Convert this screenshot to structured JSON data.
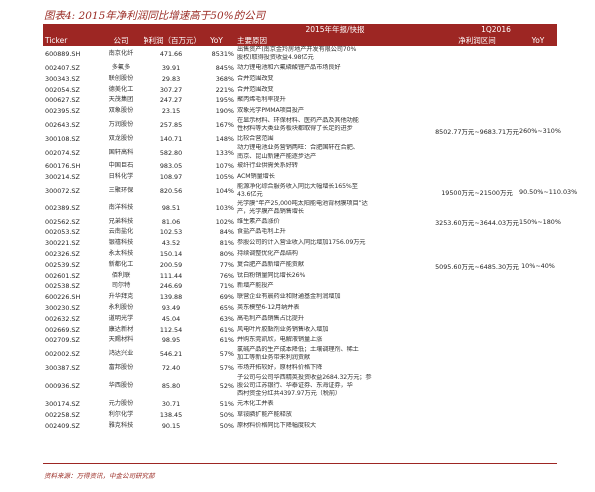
{
  "title": "图表4: 2015年净利润同比增速高于50%的公司",
  "header": {
    "group_2015": "2015年年报/快报",
    "group_1q2016": "1Q2016",
    "columns": [
      "Ticker",
      "公司",
      "净利润（百万元）",
      "YoY",
      "主要原因",
      "净利润区间",
      "YoY"
    ]
  },
  "rows": [
    {
      "ticker": "600889.SH",
      "name": "南京化纤",
      "profit": "471.66",
      "yoy": "8531%",
      "reason": [
        "出售资产(南京金羚房地产开发有限公司70%",
        "股权)取得投资收益4.98亿元"
      ]
    },
    {
      "ticker": "002407.SZ",
      "name": "多氟多",
      "profit": "39.91",
      "yoy": "845%",
      "reason": [
        "动力锂电池和六氟磷酸锂产品市场良好"
      ]
    },
    {
      "ticker": "300343.SZ",
      "name": "联创股份",
      "profit": "29.83",
      "yoy": "368%",
      "reason": [
        "合并范围改变"
      ]
    },
    {
      "ticker": "002054.SZ",
      "name": "德美化工",
      "profit": "307.27",
      "yoy": "221%",
      "reason": [
        "合并范围改变"
      ]
    },
    {
      "ticker": "000627.SZ",
      "name": "天茂集团",
      "profit": "247.27",
      "yoy": "195%",
      "reason": [
        "聚丙烯毛利率提升"
      ]
    },
    {
      "ticker": "002395.SZ",
      "name": "双象股份",
      "profit": "23.15",
      "yoy": "190%",
      "reason": [
        "双象光学PMMA项目投产"
      ]
    },
    {
      "ticker": "002643.SZ",
      "name": "万润股份",
      "profit": "257.85",
      "yoy": "167%",
      "reason": [
        "在显示材料、环保材料、医药产品及其他功能",
        "性材料等大类业务板块都取得了长足的进步"
      ]
    },
    {
      "ticker": "300108.SZ",
      "name": "双龙股份",
      "profit": "140.71",
      "yoy": "148%",
      "reason": [
        "比较合营范围"
      ]
    },
    {
      "ticker": "002074.SZ",
      "name": "国轩高科",
      "profit": "582.80",
      "yoy": "133%",
      "reason": [
        "动力锂电池业务营销两旺：合肥国轩在合肥、",
        "南京、昆山新建产能逐步达产"
      ]
    },
    {
      "ticker": "600176.SH",
      "name": "中国巨石",
      "profit": "983.05",
      "yoy": "107%",
      "reason": [
        "玻纤行业供需关系好转"
      ]
    },
    {
      "ticker": "300214.SZ",
      "name": "日科化学",
      "profit": "108.97",
      "yoy": "105%",
      "reason": [
        "ACM销量增长"
      ]
    },
    {
      "ticker": "300072.SZ",
      "name": "三聚环保",
      "profit": "820.56",
      "yoy": "104%",
      "reason": [
        "能源净化综合服务收入同比大幅增长165%至",
        "43.6亿元"
      ]
    },
    {
      "ticker": "002389.SZ",
      "name": "南洋科技",
      "profit": "98.51",
      "yoy": "103%",
      "reason": [
        "光学膜“年产25,000吨太阳能电池背材膜项目”达",
        "产，光学膜产品销售增长"
      ]
    },
    {
      "ticker": "002562.SZ",
      "name": "兄弟科技",
      "profit": "81.06",
      "yoy": "102%",
      "reason": [
        "维生素产品涨价"
      ]
    },
    {
      "ticker": "002053.SZ",
      "name": "云南盐化",
      "profit": "102.53",
      "yoy": "84%",
      "reason": [
        "食盐产品毛利上升"
      ]
    },
    {
      "ticker": "300221.SZ",
      "name": "银禧科技",
      "profit": "43.52",
      "yoy": "81%",
      "reason": [
        "参股公司的计入营业收入同比增加1756.09万元"
      ]
    },
    {
      "ticker": "002326.SZ",
      "name": "永太科技",
      "profit": "150.14",
      "yoy": "80%",
      "reason": [
        "持续调整优化产品结构"
      ]
    },
    {
      "ticker": "002539.SZ",
      "name": "新都化工",
      "profit": "200.59",
      "yoy": "77%",
      "reason": [
        "复合肥产品新增产能贡献"
      ]
    },
    {
      "ticker": "002601.SZ",
      "name": "佰利联",
      "profit": "111.44",
      "yoy": "76%",
      "reason": [
        "钛白粉销量同比增长26%"
      ]
    },
    {
      "ticker": "002538.SZ",
      "name": "司尔特",
      "profit": "246.69",
      "yoy": "71%",
      "reason": [
        "新增产能投产"
      ]
    },
    {
      "ticker": "600226.SH",
      "name": "升华拜克",
      "profit": "139.88",
      "yoy": "69%",
      "reason": [
        "联营企业有晨药业和财通基金利润增加"
      ]
    },
    {
      "ticker": "300230.SZ",
      "name": "永利股份",
      "profit": "93.49",
      "yoy": "65%",
      "reason": [
        "英东模塑6-12月纳并表"
      ]
    },
    {
      "ticker": "002632.SZ",
      "name": "道明光学",
      "profit": "45.04",
      "yoy": "63%",
      "reason": [
        "高毛利产品销售占比提升"
      ]
    },
    {
      "ticker": "002669.SZ",
      "name": "康达新材",
      "profit": "112.54",
      "yoy": "61%",
      "reason": [
        "风电叶片胶黏剂业务销售收入增加"
      ]
    },
    {
      "ticker": "002709.SZ",
      "name": "天赐材料",
      "profit": "98.95",
      "yoy": "61%",
      "reason": [
        "并购东莞凯欣，电解液销量上涨"
      ]
    },
    {
      "ticker": "002002.SZ",
      "name": "鸿达兴业",
      "profit": "546.21",
      "yoy": "57%",
      "reason": [
        "氯碱产品的生产成本降低；土壤调理剂、稀土",
        "加工等新业务带来利润贡献"
      ]
    },
    {
      "ticker": "300387.SZ",
      "name": "富邦股份",
      "profit": "72.40",
      "yoy": "57%",
      "reason": [
        "市场开拓较好，原材料价格下降"
      ]
    },
    {
      "ticker": "000936.SZ",
      "name": "华西股份",
      "profit": "85.80",
      "yoy": "52%",
      "reason": [
        "子公司与公司华西精英投资收益2684.32万元；参",
        "股公司江苏银行、华泰证券、东海证券，华",
        "西村资金分红共4397.97万元（税前）"
      ]
    },
    {
      "ticker": "300174.SZ",
      "name": "元力股份",
      "profit": "30.71",
      "yoy": "51%",
      "reason": [
        "元木化工并表"
      ]
    },
    {
      "ticker": "002258.SZ",
      "name": "利尔化学",
      "profit": "138.45",
      "yoy": "50%",
      "reason": [
        "草铵膦扩能产能释放"
      ]
    },
    {
      "ticker": "002409.SZ",
      "name": "雅克科技",
      "profit": "90.15",
      "yoy": "50%",
      "reason": [
        "原材料价格同比下降幅度较大"
      ]
    }
  ],
  "q1_2016": [
    {
      "range": "8502.77万元~9683.71万元",
      "yoy": "260%~310%"
    },
    {
      "range": "19500万元~21500万元",
      "yoy": "90.50%~110.03%"
    },
    {
      "range": "3253.60万元~3644.03万元",
      "yoy": "150%~180%"
    },
    {
      "range": "5095.60万元~6485.30万元",
      "yoy": "10%~40%"
    }
  ],
  "footer": "资料来源：万得资讯，中金公司研究部"
}
